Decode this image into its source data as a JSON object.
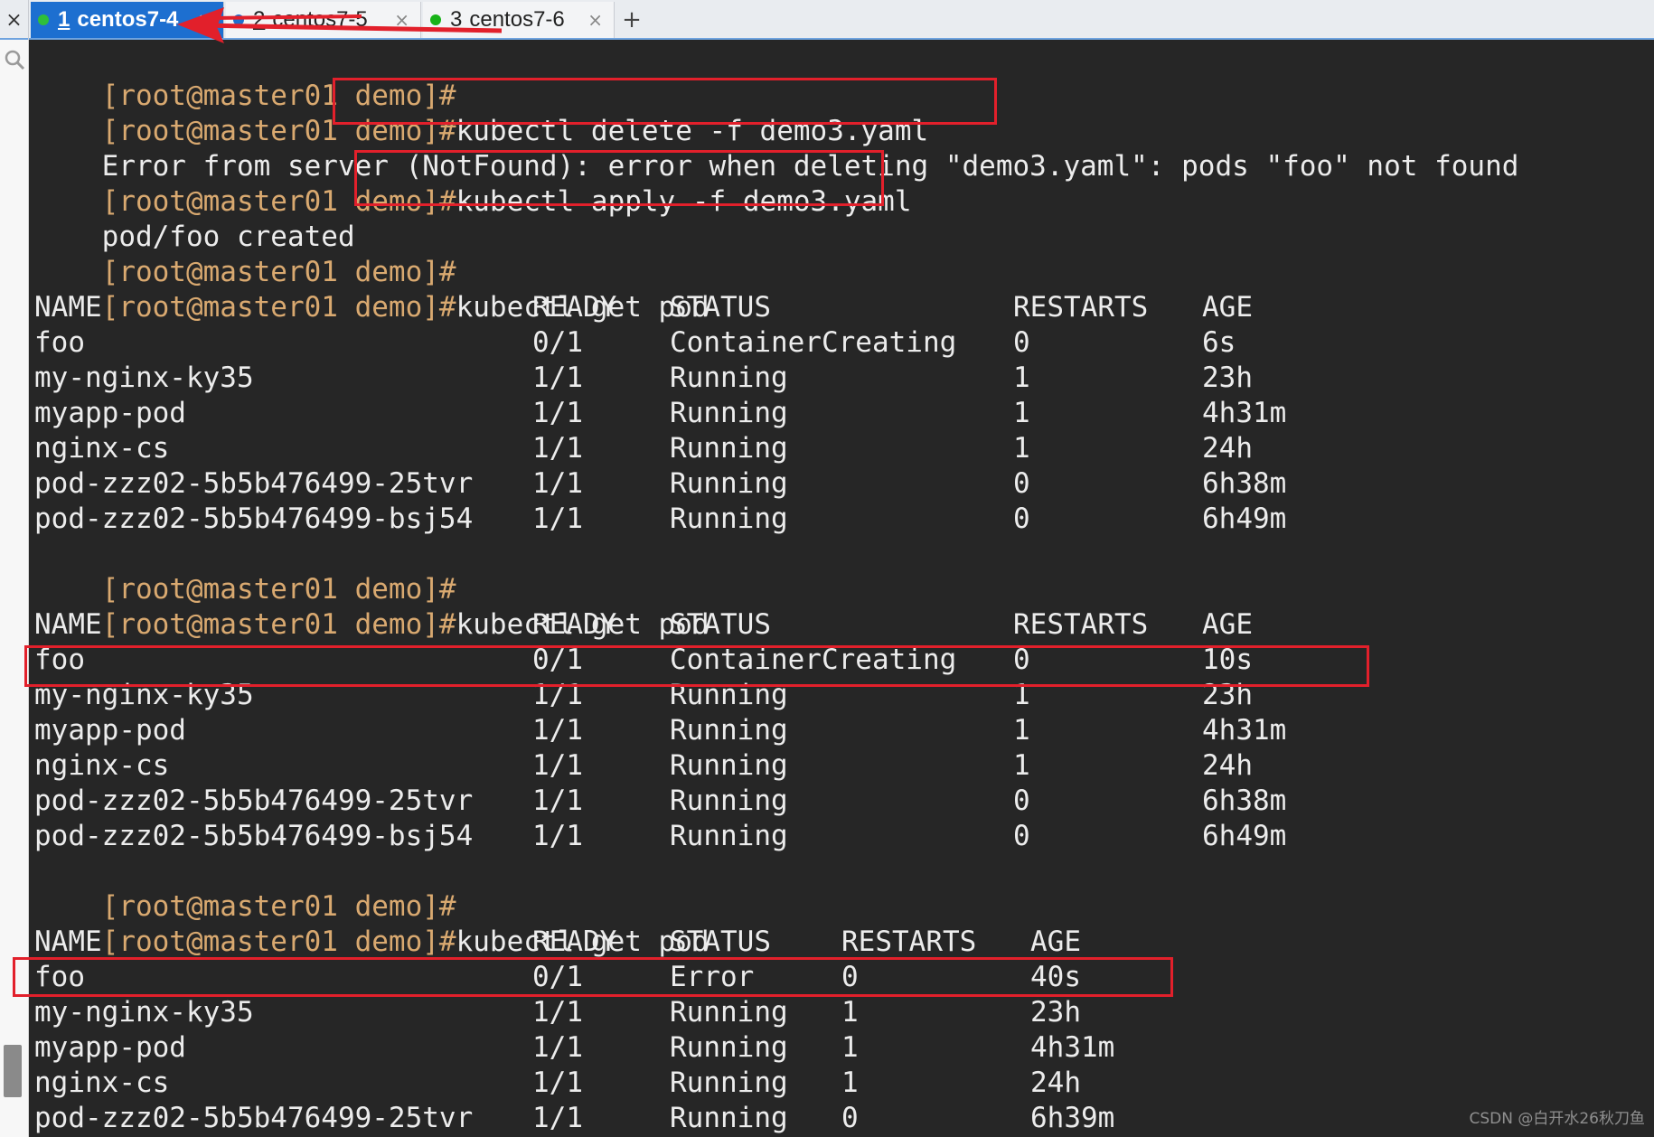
{
  "tabs": [
    {
      "num": "1",
      "name": "centos7-4",
      "status_color": "#2fbf3a",
      "active": true
    },
    {
      "num": "2",
      "name": "centos7-5",
      "status_color": "#1d6fd0",
      "active": false
    },
    {
      "num": "3",
      "name": "centos7-6",
      "status_color": "#18b318",
      "active": false
    }
  ],
  "tabbar": {
    "close_all": "×",
    "tab_close": "×",
    "new_tab": "+"
  },
  "terminal": {
    "prompt": "[root@master01 demo]#",
    "cmd_delete": "kubectl delete -f demo3.yaml",
    "error_line": "Error from server (NotFound): error when deleting \"demo3.yaml\": pods \"foo\" not found",
    "cmd_apply": "kubectl apply -f demo3.yaml",
    "created_line": "pod/foo created",
    "cmd_get": "kubectl get pod",
    "headers": [
      "NAME",
      "READY",
      "STATUS",
      "RESTARTS",
      "AGE"
    ],
    "tables": [
      [
        [
          "foo",
          "0/1",
          "ContainerCreating",
          "0",
          "6s"
        ],
        [
          "my-nginx-ky35",
          "1/1",
          "Running",
          "1",
          "23h"
        ],
        [
          "myapp-pod",
          "1/1",
          "Running",
          "1",
          "4h31m"
        ],
        [
          "nginx-cs",
          "1/1",
          "Running",
          "1",
          "24h"
        ],
        [
          "pod-zzz02-5b5b476499-25tvr",
          "1/1",
          "Running",
          "0",
          "6h38m"
        ],
        [
          "pod-zzz02-5b5b476499-bsj54",
          "1/1",
          "Running",
          "0",
          "6h49m"
        ]
      ],
      [
        [
          "foo",
          "0/1",
          "ContainerCreating",
          "0",
          "10s"
        ],
        [
          "my-nginx-ky35",
          "1/1",
          "Running",
          "1",
          "23h"
        ],
        [
          "myapp-pod",
          "1/1",
          "Running",
          "1",
          "4h31m"
        ],
        [
          "nginx-cs",
          "1/1",
          "Running",
          "1",
          "24h"
        ],
        [
          "pod-zzz02-5b5b476499-25tvr",
          "1/1",
          "Running",
          "0",
          "6h38m"
        ],
        [
          "pod-zzz02-5b5b476499-bsj54",
          "1/1",
          "Running",
          "0",
          "6h49m"
        ]
      ],
      [
        [
          "foo",
          "0/1",
          "Error",
          "0",
          "40s"
        ],
        [
          "my-nginx-ky35",
          "1/1",
          "Running",
          "1",
          "23h"
        ],
        [
          "myapp-pod",
          "1/1",
          "Running",
          "1",
          "4h31m"
        ],
        [
          "nginx-cs",
          "1/1",
          "Running",
          "1",
          "24h"
        ],
        [
          "pod-zzz02-5b5b476499-25tvr",
          "1/1",
          "Running",
          "0",
          "6h39m"
        ]
      ]
    ]
  },
  "colors": {
    "prompt": "#d9a970",
    "highlight": "#e2202b",
    "background": "#262626"
  },
  "watermark": "CSDN @白开水26秋刀鱼"
}
